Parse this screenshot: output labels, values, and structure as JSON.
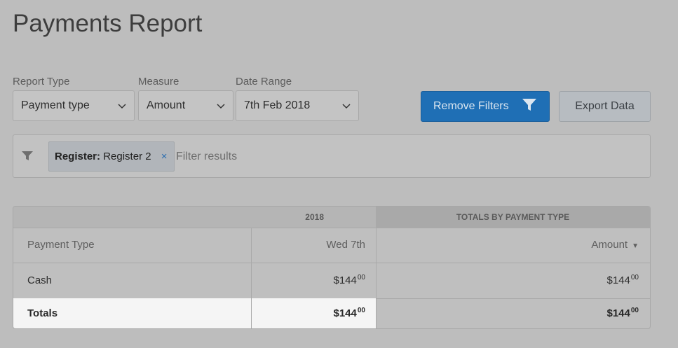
{
  "page": {
    "title": "Payments Report"
  },
  "controls": {
    "report_type": {
      "label": "Report Type",
      "value": "Payment type"
    },
    "measure": {
      "label": "Measure",
      "value": "Amount"
    },
    "date_range": {
      "label": "Date Range",
      "value": "7th Feb 2018"
    },
    "remove_filters_label": "Remove Filters",
    "export_label": "Export Data"
  },
  "filterbar": {
    "chip_key": "Register:",
    "chip_value": "Register 2",
    "chip_remove": "×",
    "placeholder": "Filter results"
  },
  "table": {
    "group_headers": [
      "2018",
      "TOTALS BY PAYMENT TYPE"
    ],
    "columns": [
      "Payment Type",
      "Wed 7th",
      "Amount"
    ],
    "sort_indicator": "▼",
    "rows": [
      {
        "type": "Cash",
        "day_value": "$144",
        "day_cents": "00",
        "total_value": "$144",
        "total_cents": "00"
      }
    ],
    "totals": {
      "label": "Totals",
      "day_value": "$144",
      "day_cents": "00",
      "total_value": "$144",
      "total_cents": "00"
    }
  },
  "colors": {
    "primary": "#1f6fb5",
    "overlay": "#bdbdbd"
  },
  "icons": [
    "chevron-down-icon",
    "filter-icon",
    "close-icon",
    "sort-desc-icon"
  ]
}
